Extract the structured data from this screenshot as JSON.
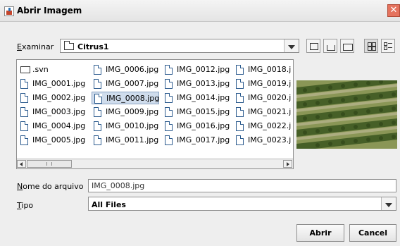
{
  "window": {
    "title": "Abrir Imagem",
    "close_glyph": "✕"
  },
  "look_in": {
    "label_first": "E",
    "label_rest": "xaminar",
    "folder": "Citrus1"
  },
  "toolbar": {
    "icons": [
      "up-one-level-icon",
      "home-icon",
      "new-folder-icon",
      "list-view-icon",
      "details-view-icon"
    ]
  },
  "files": {
    "columns": [
      [
        ".svn",
        "IMG_0001.jpg",
        "IMG_0002.jpg",
        "IMG_0003.jpg",
        "IMG_0004.jpg",
        "IMG_0005.jpg"
      ],
      [
        "IMG_0006.jpg",
        "IMG_0007.jpg",
        "IMG_0008.jpg",
        "IMG_0009.jpg",
        "IMG_0010.jpg",
        "IMG_0011.jpg"
      ],
      [
        "IMG_0012.jpg",
        "IMG_0013.jpg",
        "IMG_0014.jpg",
        "IMG_0015.jpg",
        "IMG_0016.jpg",
        "IMG_0017.jpg"
      ],
      [
        "IMG_0018.j",
        "IMG_0019.j",
        "IMG_0020.j",
        "IMG_0021.j",
        "IMG_0022.j",
        "IMG_0023.j"
      ]
    ],
    "selected": "IMG_0008.jpg"
  },
  "filename": {
    "label_first": "N",
    "label_rest": "ome do arquivo",
    "value": "IMG_0008.jpg"
  },
  "filetype": {
    "label_first": "T",
    "label_rest": "ipo",
    "value": "All Files"
  },
  "buttons": {
    "open": "Abrir",
    "cancel": "Cancel"
  },
  "colors": {
    "selection": "#cfdcec",
    "title_close": "#e5735e",
    "preview_ground": "#7e8c4c"
  }
}
